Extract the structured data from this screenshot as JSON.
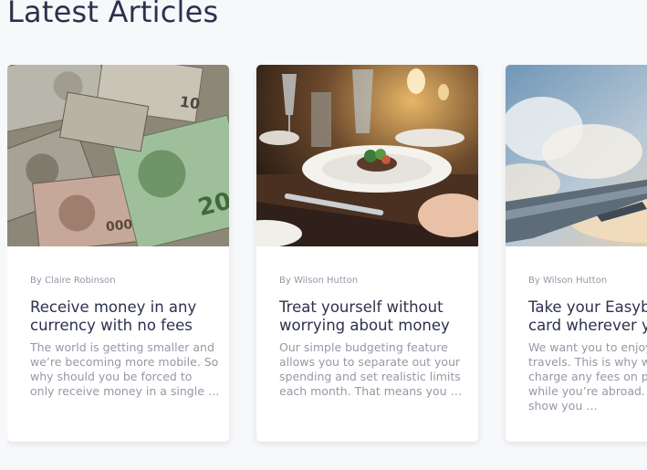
{
  "section": {
    "title": "Latest Articles"
  },
  "articles": [
    {
      "author": "By Claire Robinson",
      "title_lines": [
        "Receive money in any",
        "currency with no fees"
      ],
      "excerpt_lines": [
        "The world is getting smaller and",
        "we’re becoming more mobile. So",
        "why should you be forced to",
        "only receive money in a single …"
      ],
      "image": "currency-notes-image"
    },
    {
      "author": "By Wilson Hutton",
      "title_lines": [
        "Treat yourself without",
        "worrying about money"
      ],
      "excerpt_lines": [
        "Our simple budgeting feature",
        "allows you to separate out your",
        "spending and set realistic limits",
        "each month. That means you …"
      ],
      "image": "restaurant-dinner-image"
    },
    {
      "author": "By Wilson Hutton",
      "title_lines": [
        "Take your Easyba",
        "card wherever yo"
      ],
      "excerpt_lines": [
        "We want you to enjoy y",
        "travels. This is why we",
        "charge any fees on pu",
        "while you’re abroad. W",
        "show you …"
      ],
      "image": "airplane-wing-image"
    }
  ],
  "colors": {
    "background": "#f7f8fa",
    "card": "#ffffff",
    "heading": "#2d314d",
    "muted": "#9698a6"
  }
}
